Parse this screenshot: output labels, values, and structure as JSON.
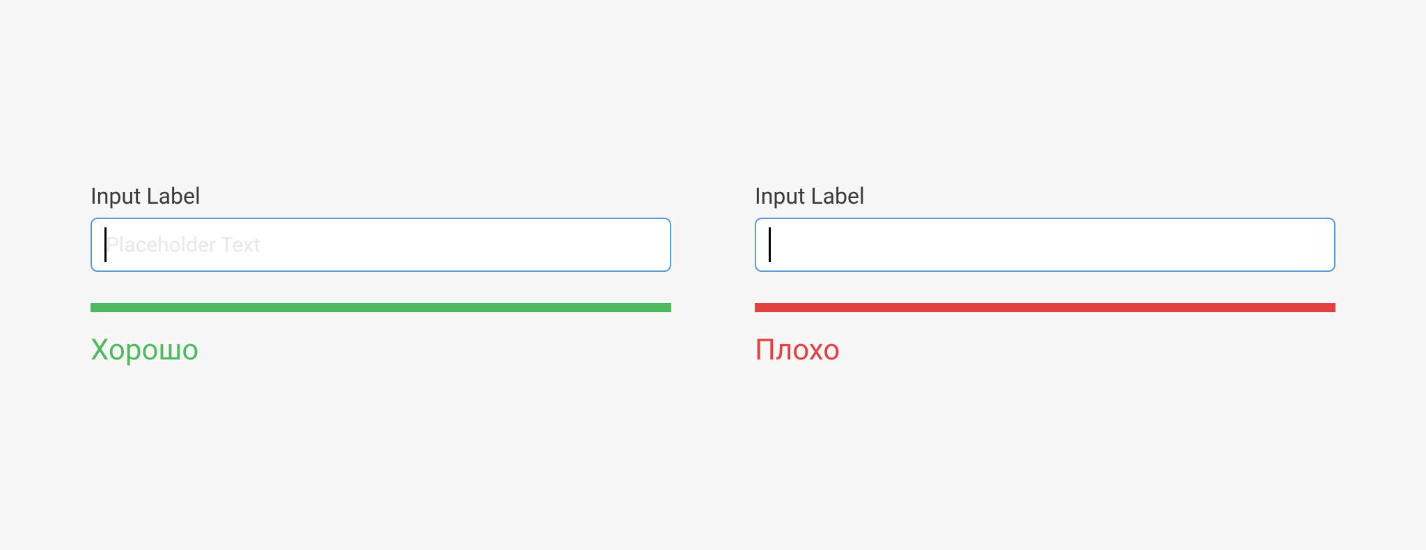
{
  "good": {
    "label": "Input Label",
    "placeholder": "Placeholder Text",
    "status": "Хорошо"
  },
  "bad": {
    "label": "Input Label",
    "placeholder": "",
    "status": "Плохо"
  },
  "colors": {
    "good": "#4eba5e",
    "bad": "#e34040",
    "border": "#5a9bd5"
  }
}
